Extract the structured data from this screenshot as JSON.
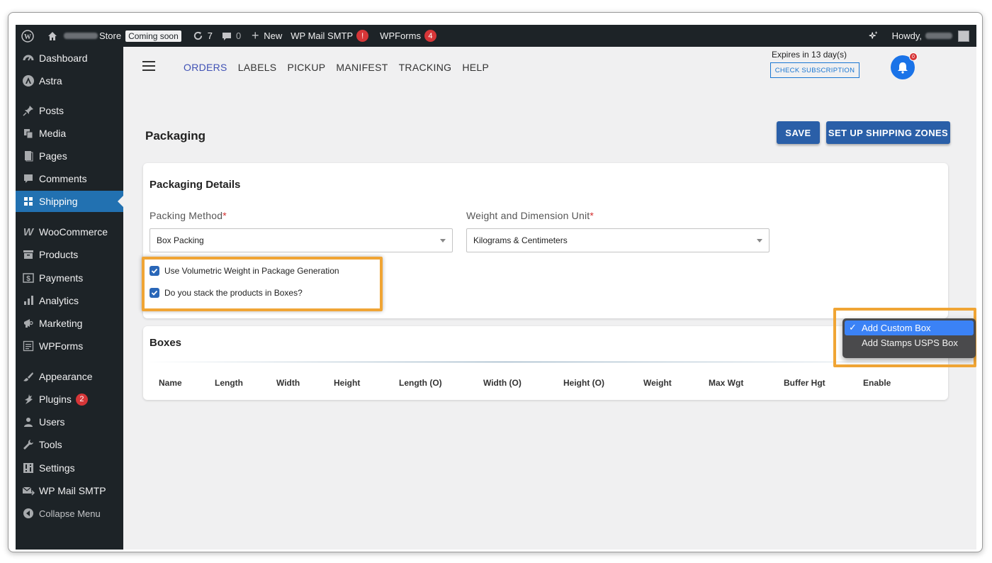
{
  "adminbar": {
    "site_suffix": "Store",
    "coming_soon": "Coming soon",
    "updates_count": "7",
    "comments_count": "0",
    "new_label": "New",
    "wp_mail_smtp": "WP Mail SMTP",
    "wp_mail_smtp_badge": "!",
    "wpforms": "WPForms",
    "wpforms_badge": "4",
    "howdy": "Howdy,"
  },
  "sidebar": {
    "items": [
      {
        "label": "Dashboard",
        "icon": "dashboard-icon"
      },
      {
        "label": "Astra",
        "icon": "astra-icon"
      },
      {
        "label": "Posts",
        "icon": "pin-icon"
      },
      {
        "label": "Media",
        "icon": "media-icon"
      },
      {
        "label": "Pages",
        "icon": "page-icon"
      },
      {
        "label": "Comments",
        "icon": "comment-icon"
      },
      {
        "label": "Shipping",
        "icon": "grid-icon"
      },
      {
        "label": "WooCommerce",
        "icon": "woo-icon"
      },
      {
        "label": "Products",
        "icon": "archive-icon"
      },
      {
        "label": "Payments",
        "icon": "dollar-icon"
      },
      {
        "label": "Analytics",
        "icon": "bar-chart-icon"
      },
      {
        "label": "Marketing",
        "icon": "megaphone-icon"
      },
      {
        "label": "WPForms",
        "icon": "form-icon"
      },
      {
        "label": "Appearance",
        "icon": "brush-icon"
      },
      {
        "label": "Plugins",
        "icon": "plug-icon",
        "badge": "2"
      },
      {
        "label": "Users",
        "icon": "user-icon"
      },
      {
        "label": "Tools",
        "icon": "wrench-icon"
      },
      {
        "label": "Settings",
        "icon": "settings-icon"
      },
      {
        "label": "WP Mail SMTP",
        "icon": "mail-icon"
      },
      {
        "label": "Collapse Menu",
        "icon": "collapse-icon"
      }
    ],
    "active": "Shipping"
  },
  "nav": {
    "links": [
      "ORDERS",
      "LABELS",
      "PICKUP",
      "MANIFEST",
      "TRACKING",
      "HELP"
    ],
    "active": "ORDERS"
  },
  "subscription": {
    "expires": "Expires in 13 day(s)",
    "check_label": "CHECK SUBSCRIPTION",
    "notification_count": "0"
  },
  "page": {
    "title": "Packaging",
    "save_label": "SAVE",
    "zones_label": "SET UP SHIPPING ZONES"
  },
  "packaging": {
    "title": "Packaging Details",
    "method_label": "Packing Method",
    "method_value": "Box Packing",
    "unit_label": "Weight and Dimension Unit",
    "unit_value": "Kilograms & Centimeters",
    "required_mark": "*",
    "volumetric_label": "Use Volumetric Weight in Package Generation",
    "volumetric_checked": true,
    "stack_label": "Do you stack the products in Boxes?",
    "stack_checked": true
  },
  "boxes": {
    "title": "Boxes",
    "columns": [
      "Name",
      "Length",
      "Width",
      "Height",
      "Length (O)",
      "Width (O)",
      "Height (O)",
      "Weight",
      "Max Wgt",
      "Buffer Hgt",
      "Enable"
    ]
  },
  "dropdown": {
    "options": [
      "Add Custom Box",
      "Add Stamps USPS Box"
    ],
    "selected": "Add Custom Box",
    "check_mark": "✓"
  },
  "colors": {
    "admin_dark": "#1d2327",
    "wp_blue": "#2271b1",
    "primary_button": "#2a5fa8",
    "highlight": "#f0a535",
    "badge_red": "#d63638"
  }
}
